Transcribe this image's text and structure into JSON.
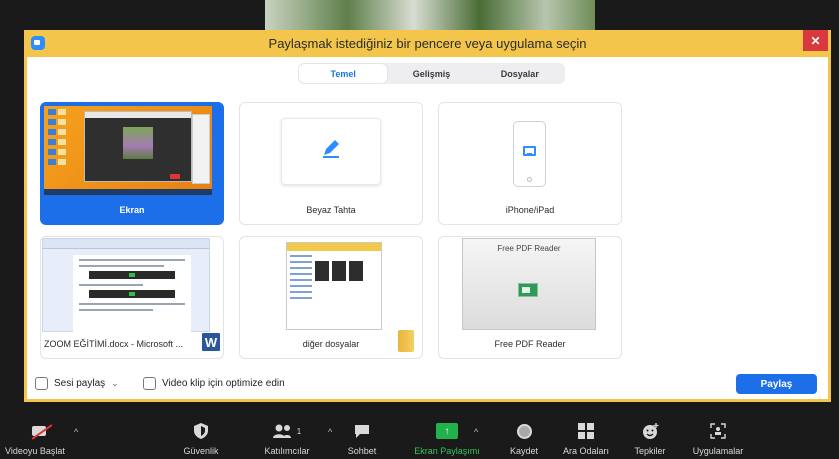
{
  "dialog": {
    "title": "Paylaşmak istediğiniz bir pencere veya uygulama seçin",
    "close": "✕"
  },
  "tabs": [
    {
      "label": "Temel",
      "active": true
    },
    {
      "label": "Gelişmiş",
      "active": false
    },
    {
      "label": "Dosyalar",
      "active": false
    }
  ],
  "cards": {
    "screen": {
      "label": "Ekran",
      "selected": true
    },
    "whiteboard": {
      "label": "Beyaz Tahta",
      "icon": "pen-icon"
    },
    "iphone": {
      "label": "iPhone/iPad",
      "icon": "airplay-icon"
    },
    "word": {
      "label": "ZOOM EĞİTİMİ.docx - Microsoft ...",
      "icon": "word-icon",
      "icon_letter": "W"
    },
    "folder": {
      "label": "diğer dosyalar",
      "icon": "folder-icon"
    },
    "pdf": {
      "label": "Free PDF Reader",
      "thumb_title": "Free PDF Reader"
    }
  },
  "options": {
    "share_sound": "Sesi paylaş",
    "share_sound_chevron": "⌄",
    "optimize_video": "Video klip için optimize edin",
    "share_button": "Paylaş"
  },
  "toolbar": {
    "start_video": "Videoyu Başlat",
    "security": "Güvenlik",
    "participants": "Katılımcılar",
    "participant_count": "1",
    "chat": "Sohbet",
    "share_screen": "Ekran Paylaşımı",
    "record": "Kaydet",
    "breakout_rooms": "Ara Odaları",
    "reactions": "Tepkiler",
    "apps": "Uygulamalar",
    "caret": "^"
  },
  "colors": {
    "accent": "#1c6fe8",
    "title_bar": "#f3c54b",
    "close": "#d9393c",
    "share_green": "#23b14d"
  }
}
